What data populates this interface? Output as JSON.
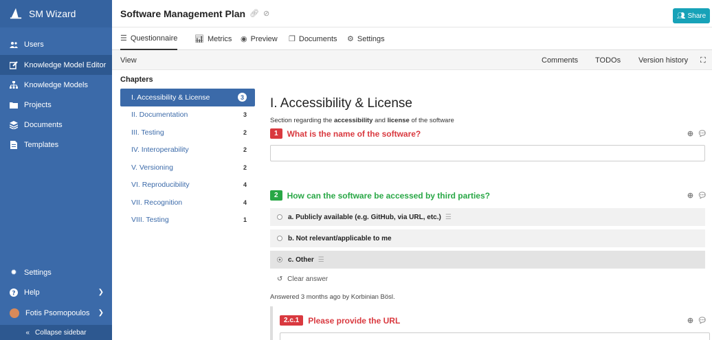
{
  "sidebar": {
    "brand": "SM Wizard",
    "items": [
      {
        "label": "Users",
        "icon": "users-icon"
      },
      {
        "label": "Knowledge Model Editor",
        "icon": "edit-icon"
      },
      {
        "label": "Knowledge Models",
        "icon": "sitemap-icon"
      },
      {
        "label": "Projects",
        "icon": "folder-icon"
      },
      {
        "label": "Documents",
        "icon": "layers-icon"
      },
      {
        "label": "Templates",
        "icon": "file-icon"
      }
    ],
    "settings": "Settings",
    "help": "Help",
    "user": "Fotis Psomopoulos",
    "collapse": "Collapse sidebar"
  },
  "header": {
    "title": "Software Management Plan",
    "share": "Share"
  },
  "tabs": [
    {
      "label": "Questionnaire",
      "icon": "list-icon"
    },
    {
      "label": "Metrics",
      "icon": "chart-icon"
    },
    {
      "label": "Preview",
      "icon": "eye-icon"
    },
    {
      "label": "Documents",
      "icon": "copy-icon"
    },
    {
      "label": "Settings",
      "icon": "cogs-icon"
    }
  ],
  "subbar": {
    "view": "View",
    "comments": "Comments",
    "todos": "TODOs",
    "history": "Version history"
  },
  "chapters": {
    "heading": "Chapters",
    "items": [
      {
        "label": "I. Accessibility & License",
        "count": "3"
      },
      {
        "label": "II. Documentation",
        "count": "3"
      },
      {
        "label": "III. Testing",
        "count": "2"
      },
      {
        "label": "IV. Interoperability",
        "count": "2"
      },
      {
        "label": "V. Versioning",
        "count": "2"
      },
      {
        "label": "VI. Reproducibility",
        "count": "4"
      },
      {
        "label": "VII. Recognition",
        "count": "4"
      },
      {
        "label": "VIII. Testing",
        "count": "1"
      }
    ]
  },
  "content": {
    "title": "I. Accessibility & License",
    "desc_prefix": "Section regarding the ",
    "desc_b1": "accessibility",
    "desc_mid": " and ",
    "desc_b2": "license",
    "desc_suffix": " of the software",
    "q1": {
      "num": "1",
      "text": "What is the name of the software?"
    },
    "q2": {
      "num": "2",
      "text": "How can the software be accessed by third parties?",
      "options": [
        "a. Publicly available (e.g. GitHub, via URL, etc.)",
        "b. Not relevant/applicable to me",
        "c. Other"
      ],
      "clear": "Clear answer",
      "answered": "Answered 3 months ago by Korbinian Bösl."
    },
    "q3": {
      "num": "2.c.1",
      "text": "Please provide the URL"
    }
  },
  "colors": {
    "sidebar": "#3b6aa9",
    "required": "#d9393f",
    "answered": "#28a745",
    "share": "#17a2b8"
  }
}
